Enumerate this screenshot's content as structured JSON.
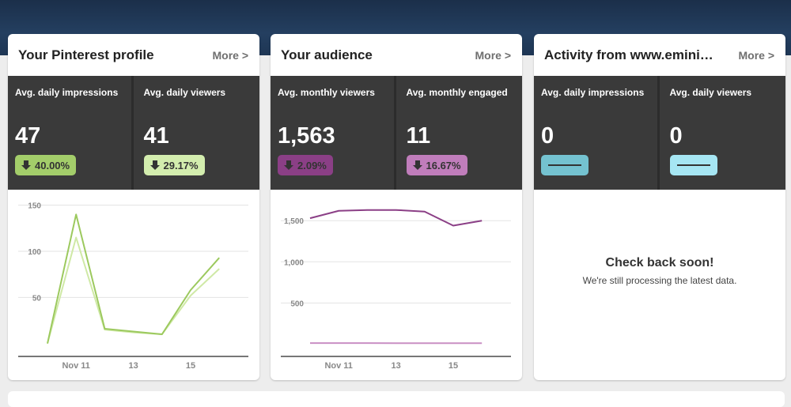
{
  "cards": [
    {
      "title": "Your Pinterest profile",
      "more": "More >",
      "stats": [
        {
          "label": "Avg. daily impressions",
          "value": "47",
          "change": "40.00%",
          "direction": "down",
          "color": "#a3cd6a"
        },
        {
          "label": "Avg. daily viewers",
          "value": "41",
          "change": "29.17%",
          "direction": "down",
          "color": "#d3edae"
        }
      ]
    },
    {
      "title": "Your audience",
      "more": "More >",
      "stats": [
        {
          "label": "Avg. monthly viewers",
          "value": "1,563",
          "change": "2.09%",
          "direction": "down",
          "color": "#8b3f86"
        },
        {
          "label": "Avg. monthly engaged",
          "value": "11",
          "change": "16.67%",
          "direction": "down",
          "color": "#c07dbb"
        }
      ]
    },
    {
      "title": "Activity from www.emini…",
      "more": "More >",
      "stats": [
        {
          "label": "Avg. daily impressions",
          "value": "0",
          "change": "",
          "direction": "none",
          "color": "#74c2d0"
        },
        {
          "label": "Avg. daily viewers",
          "value": "0",
          "change": "",
          "direction": "none",
          "color": "#a6e6f3"
        }
      ],
      "empty": {
        "title": "Check back soon!",
        "subtitle": "We're still processing the latest data."
      }
    }
  ],
  "chart_data": [
    {
      "type": "line",
      "x": [
        "Nov 10",
        "Nov 11",
        "Nov 12",
        "Nov 13",
        "Nov 14",
        "Nov 15",
        "Nov 16"
      ],
      "xticks": [
        "Nov 11",
        "13",
        "15"
      ],
      "yticks": [
        "50",
        "100",
        "150"
      ],
      "ylim": [
        -14,
        160
      ],
      "grid": true,
      "series": [
        {
          "values": [
            0,
            140,
            16,
            13,
            10,
            58,
            93
          ],
          "color": "#9cc95e"
        },
        {
          "values": [
            0,
            115,
            15,
            12,
            10,
            52,
            81
          ],
          "color": "#cfe9a6"
        }
      ]
    },
    {
      "type": "line",
      "x": [
        "Nov 10",
        "Nov 11",
        "Nov 12",
        "Nov 13",
        "Nov 14",
        "Nov 15",
        "Nov 16"
      ],
      "xticks": [
        "Nov 11",
        "13",
        "15"
      ],
      "yticks": [
        "500",
        "1,000",
        "1,500"
      ],
      "ylim": [
        -150,
        1800
      ],
      "grid": true,
      "series": [
        {
          "values": [
            1530,
            1620,
            1630,
            1630,
            1610,
            1440,
            1500
          ],
          "color": "#8b3f86"
        },
        {
          "values": [
            12,
            12,
            12,
            11,
            11,
            11,
            11
          ],
          "color": "#c98fc4"
        }
      ]
    }
  ]
}
